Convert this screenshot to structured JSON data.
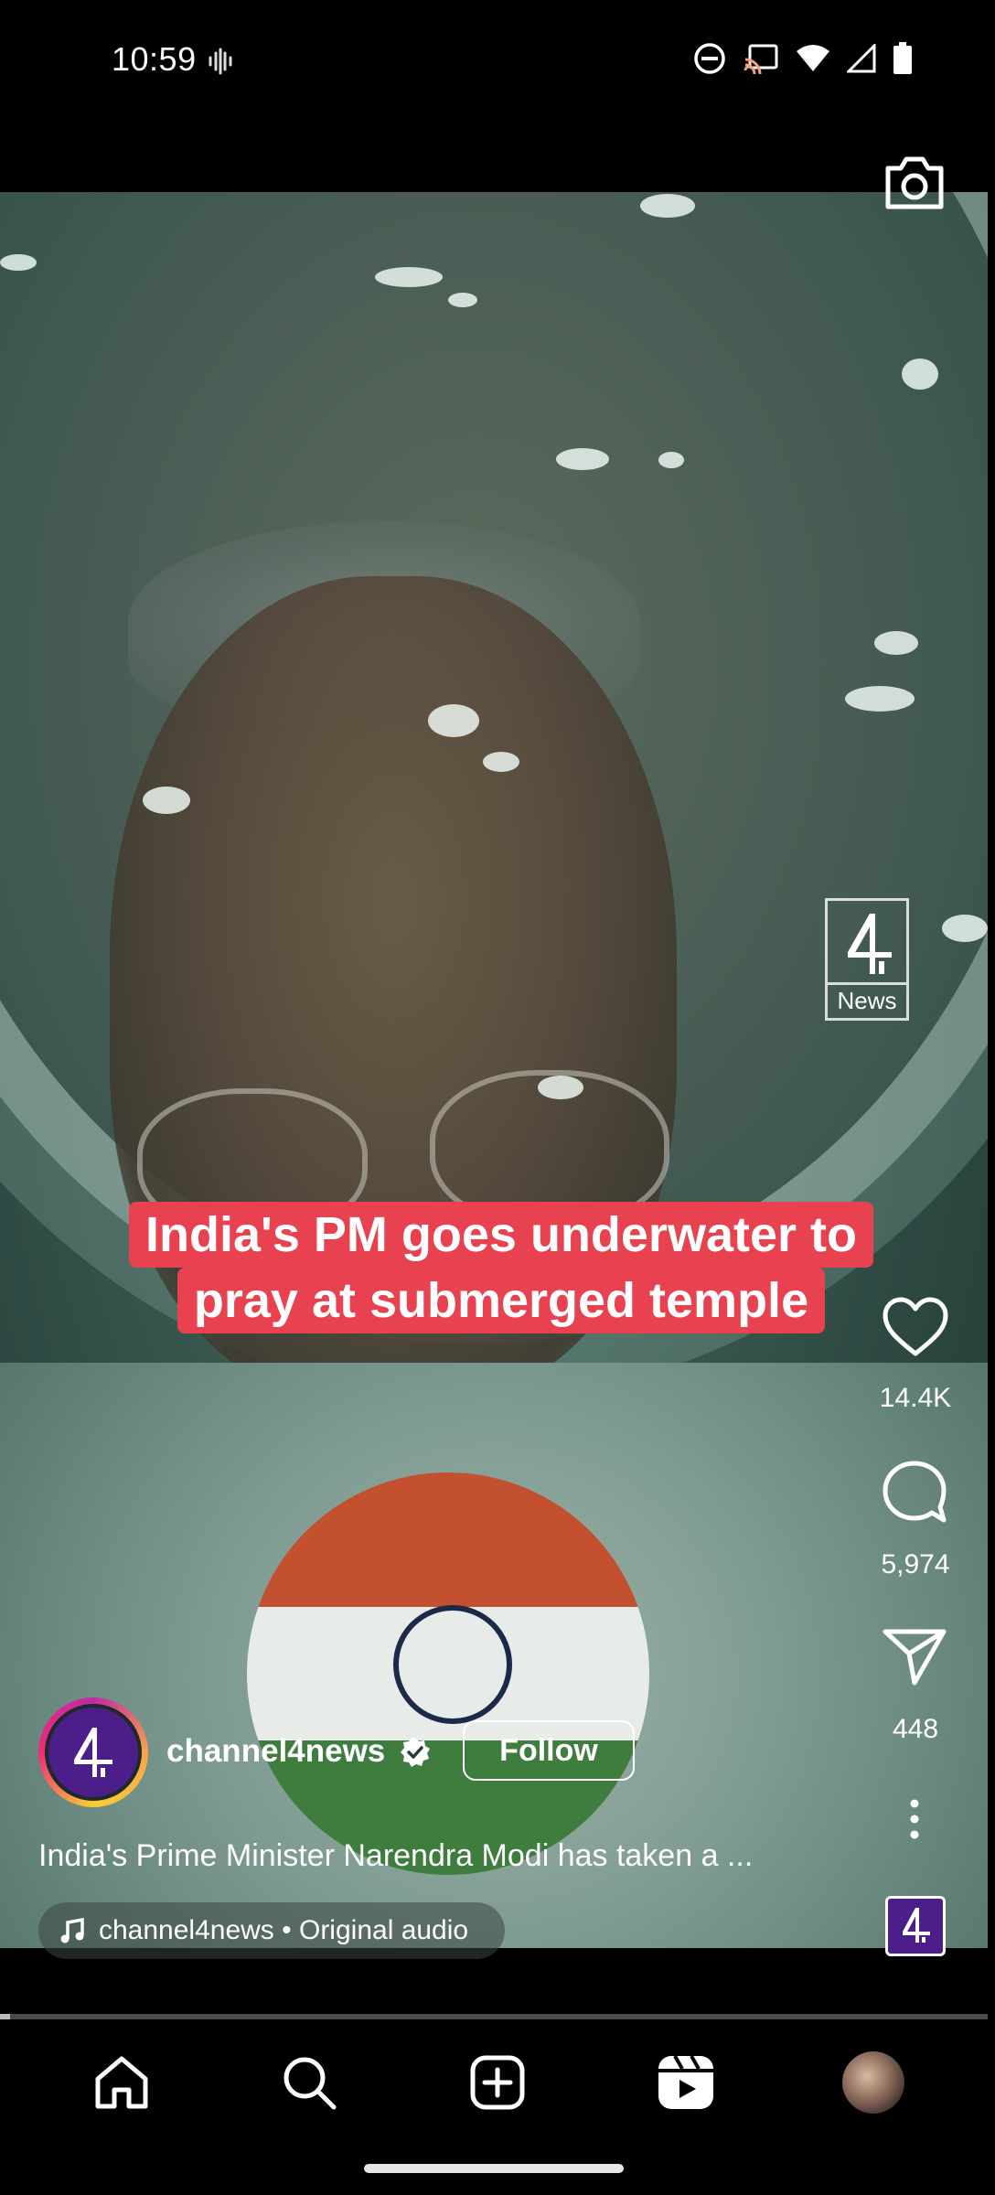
{
  "status_bar": {
    "time": "10:59"
  },
  "overlay": {
    "caption_line1": "India's PM goes underwater to",
    "caption_line2": "pray at submerged temple",
    "watermark_text": "News"
  },
  "actions": {
    "likes": "14.4K",
    "comments": "5,974",
    "shares": "448"
  },
  "post": {
    "username": "channel4news",
    "follow_label": "Follow",
    "description": "India's Prime Minister Narendra Modi has taken a ...",
    "audio_label": "channel4news • Original audio"
  },
  "playback": {
    "progress": 0.01
  },
  "bottom_nav": {
    "items": [
      "home-icon",
      "search-icon",
      "create-icon",
      "reels-icon",
      "profile-avatar"
    ]
  },
  "colors": {
    "caption_bg": "#e8414f",
    "brand_purple": "#4b1e8a"
  }
}
